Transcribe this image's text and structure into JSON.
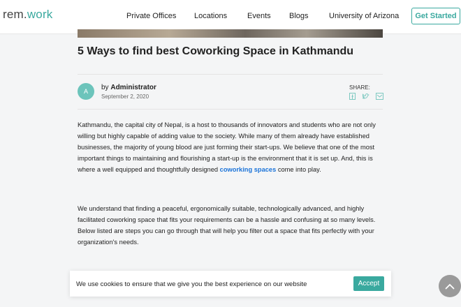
{
  "header": {
    "logo": {
      "prefix": "rem.",
      "suffix": "work"
    },
    "nav": [
      "Private Offices",
      "Locations",
      "Events",
      "Blogs",
      "University of Arizona"
    ],
    "cta": "Get Started"
  },
  "article": {
    "title": "5 Ways to find best Coworking Space in Kathmandu",
    "author": {
      "initial": "A",
      "by": "by ",
      "name": "Administrator",
      "date": "September 2, 2020"
    },
    "share": {
      "label": "SHARE:",
      "icons": [
        "facebook-icon",
        "twitter-icon",
        "email-icon"
      ]
    },
    "paragraphs": {
      "p1": "Kathmandu, the capital city of Nepal, is a host to thousands of innovators and students who are not only willing but highly capable of adding value to the society. While many of them already have established businesses, the majority of young blood are just forming their start-ups. We believe that one of the most important things to maintaining and flourishing a start-up is the environment that it is set up. And, this is where a well equipped and thoughtfully designed ",
      "p1_link": "coworking spaces",
      "p1_tail": " come into play.",
      "p2": "We understand that finding a peaceful, ergonomically suitable, technologically advanced, and highly facilitated coworking space that fits your requirements can be a hassle and confusing at so many levels. Below listed are steps you can go through that will help you filter out a space that fits perfectly with your organization's needs."
    }
  },
  "cookie": {
    "message": "We use cookies to ensure that we give you the best experience on our website",
    "accept": "Accept"
  },
  "colors": {
    "accent": "#3aa99f",
    "link": "#1a73d9",
    "background": "#f4f5f6"
  }
}
